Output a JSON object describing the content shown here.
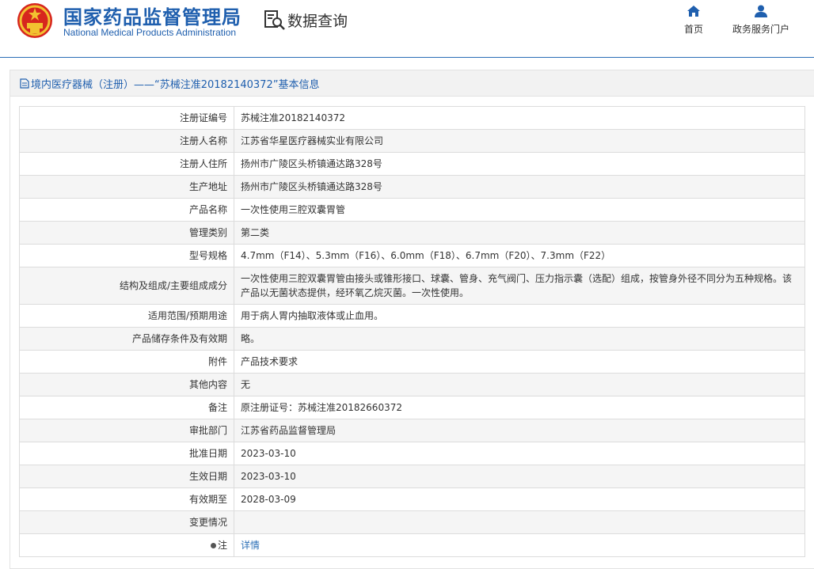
{
  "header": {
    "brand_cn": "国家药品监督管理局",
    "brand_en": "National Medical Products Administration",
    "search_label": "数据查询",
    "nav": {
      "home": "首页",
      "portal": "政务服务门户"
    }
  },
  "panel": {
    "title": "境内医疗器械（注册）——“苏械注准20182140372”基本信息"
  },
  "rows": [
    {
      "k": "注册证编号",
      "v": "苏械注准20182140372"
    },
    {
      "k": "注册人名称",
      "v": "江苏省华星医疗器械实业有限公司"
    },
    {
      "k": "注册人住所",
      "v": "扬州市广陵区头桥镇通达路328号"
    },
    {
      "k": "生产地址",
      "v": "扬州市广陵区头桥镇通达路328号"
    },
    {
      "k": "产品名称",
      "v": "一次性使用三腔双囊胃管"
    },
    {
      "k": "管理类别",
      "v": "第二类"
    },
    {
      "k": "型号规格",
      "v": "4.7mm（F14）、5.3mm（F16）、6.0mm（F18）、6.7mm（F20）、7.3mm（F22）"
    },
    {
      "k": "结构及组成/主要组成成分",
      "v": "一次性使用三腔双囊胃管由接头或锥形接口、球囊、管身、充气阀门、压力指示囊（选配）组成，按管身外径不同分为五种规格。该产品以无菌状态提供，经环氧乙烷灭菌。一次性使用。"
    },
    {
      "k": "适用范围/预期用途",
      "v": "用于病人胃内抽取液体或止血用。"
    },
    {
      "k": "产品储存条件及有效期",
      "v": "略。"
    },
    {
      "k": "附件",
      "v": "产品技术要求"
    },
    {
      "k": "其他内容",
      "v": "无"
    },
    {
      "k": "备注",
      "v": "原注册证号：苏械注准20182660372"
    },
    {
      "k": "审批部门",
      "v": "江苏省药品监督管理局"
    },
    {
      "k": "批准日期",
      "v": "2023-03-10"
    },
    {
      "k": "生效日期",
      "v": "2023-03-10"
    },
    {
      "k": "有效期至",
      "v": "2028-03-09"
    },
    {
      "k": "变更情况",
      "v": ""
    },
    {
      "k": "注",
      "v": "详情"
    }
  ],
  "colors": {
    "brand": "#1f5fae",
    "emblem_red": "#d7261e",
    "emblem_gold": "#f2c230",
    "link": "#2b6fb6"
  },
  "icons": {
    "emblem": "national-emblem-icon",
    "search": "document-search-icon",
    "home": "home-icon",
    "portal": "user-icon",
    "title": "document-icon",
    "note": "dot-icon"
  }
}
